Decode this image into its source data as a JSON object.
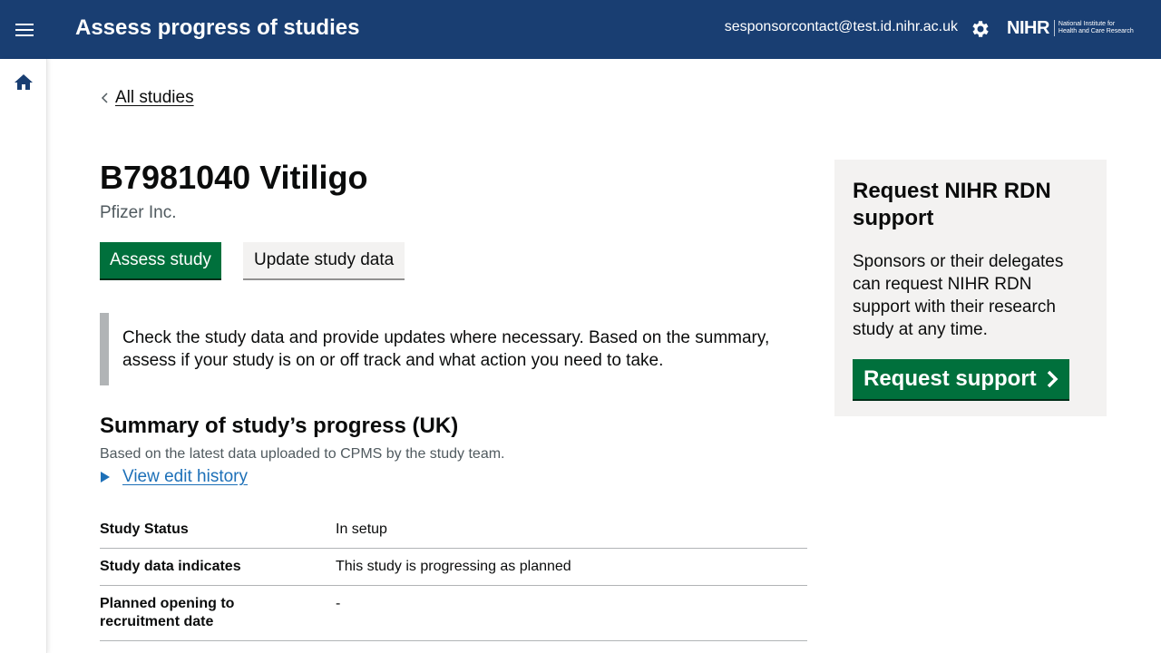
{
  "header": {
    "title": "Assess progress of studies",
    "user_email": "sesponsorcontact@test.id.nihr.ac.uk",
    "logo_word": "NIHR",
    "logo_sub_line1": "National Institute for",
    "logo_sub_line2": "Health and Care Research",
    "icons": {
      "menu": "menu-icon",
      "settings": "gear-icon",
      "home": "home-icon"
    },
    "color": "#193e72"
  },
  "breadcrumb": {
    "back_label": "All studies"
  },
  "study": {
    "title": "B7981040 Vitiligo",
    "sponsor": "Pfizer Inc."
  },
  "actions": {
    "assess_label": "Assess study",
    "update_label": "Update study data"
  },
  "inset_text": "Check the study data and provide updates where necessary. Based on the summary, assess if your study is on or off track and what action you need to take.",
  "summary": {
    "title": "Summary of study’s progress (UK)",
    "subtitle": "Based on the latest data uploaded to CPMS by the study team.",
    "history_label": "View edit history",
    "rows": [
      {
        "key": "Study Status",
        "value": "In setup"
      },
      {
        "key": "Study data indicates",
        "value": "This study is progressing as planned"
      },
      {
        "key": "Planned opening to recruitment date",
        "value": "-"
      }
    ]
  },
  "side_panel": {
    "title": "Request NIHR RDN support",
    "body": "Sponsors or their delegates can request NIHR RDN support with their research study at any time.",
    "button_label": "Request support"
  },
  "colors": {
    "primary_green": "#00703c",
    "link_blue": "#1d70b8",
    "panel_grey": "#f3f2f1"
  }
}
